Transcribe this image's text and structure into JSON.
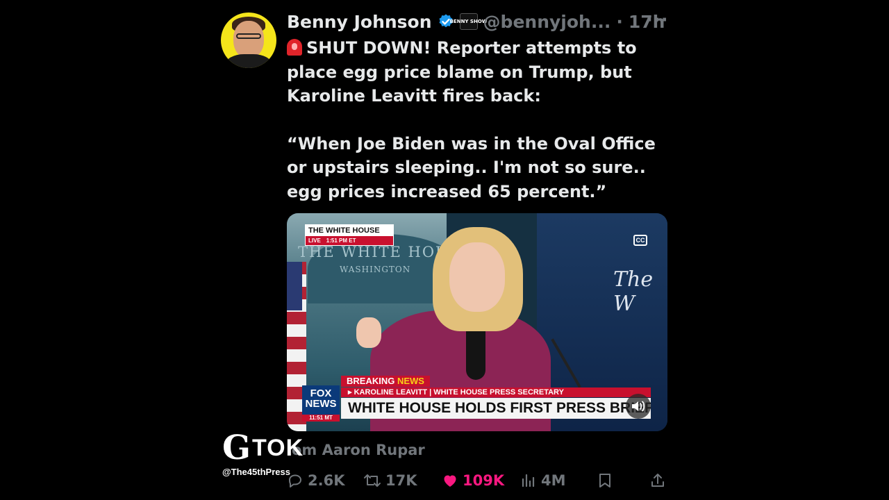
{
  "author": {
    "name": "Benny Johnson",
    "handle": "@bennyjoh...",
    "separator": "·",
    "time": "17h",
    "affiliate_badge_text": "BENNY SHOW"
  },
  "tweet": {
    "line1": "SHUT DOWN! Reporter attempts to place egg price blame on Trump, but Karoline Leavitt fires back:",
    "line2": "“When Joe Biden was in the Oval Office or upstairs sleeping.. I'm not so sure.. egg prices increased 65 percent.”",
    "siren_icon": "rotating-light-icon"
  },
  "video": {
    "bug_title": "THE WHITE HOUSE",
    "bug_live": "LIVE",
    "bug_time": "1:51 PM ET",
    "bg_arch_text": "THE WHITE HOUS",
    "bg_arch_sub": "WASHINGTON",
    "bg_right_text": "The W",
    "cc_label": "CC",
    "breaking_label": "BREAKING",
    "news_label": "NEWS",
    "nameplate": "▸ KAROLINE LEAVITT | WHITE HOUSE PRESS SECRETARY",
    "headline": "WHITE HOUSE HOLDS FIRST PRESS BRIEFING",
    "fox_logo_top": "FOX",
    "fox_logo_bottom": "NEWS",
    "fox_time": "11:51 MT"
  },
  "source": {
    "text": "om Aaron Rupar"
  },
  "watermark": {
    "logo_letter": "G",
    "logo_text": "TOK",
    "handle": "@The45thPress"
  },
  "actions": {
    "replies": "2.6K",
    "reposts": "17K",
    "likes": "109K",
    "views": "4M"
  },
  "colors": {
    "background": "#000000",
    "text": "#e7e9ea",
    "muted": "#71767b",
    "verified": "#1d9bf0",
    "like": "#f91880",
    "fox_red": "#c8102e"
  }
}
